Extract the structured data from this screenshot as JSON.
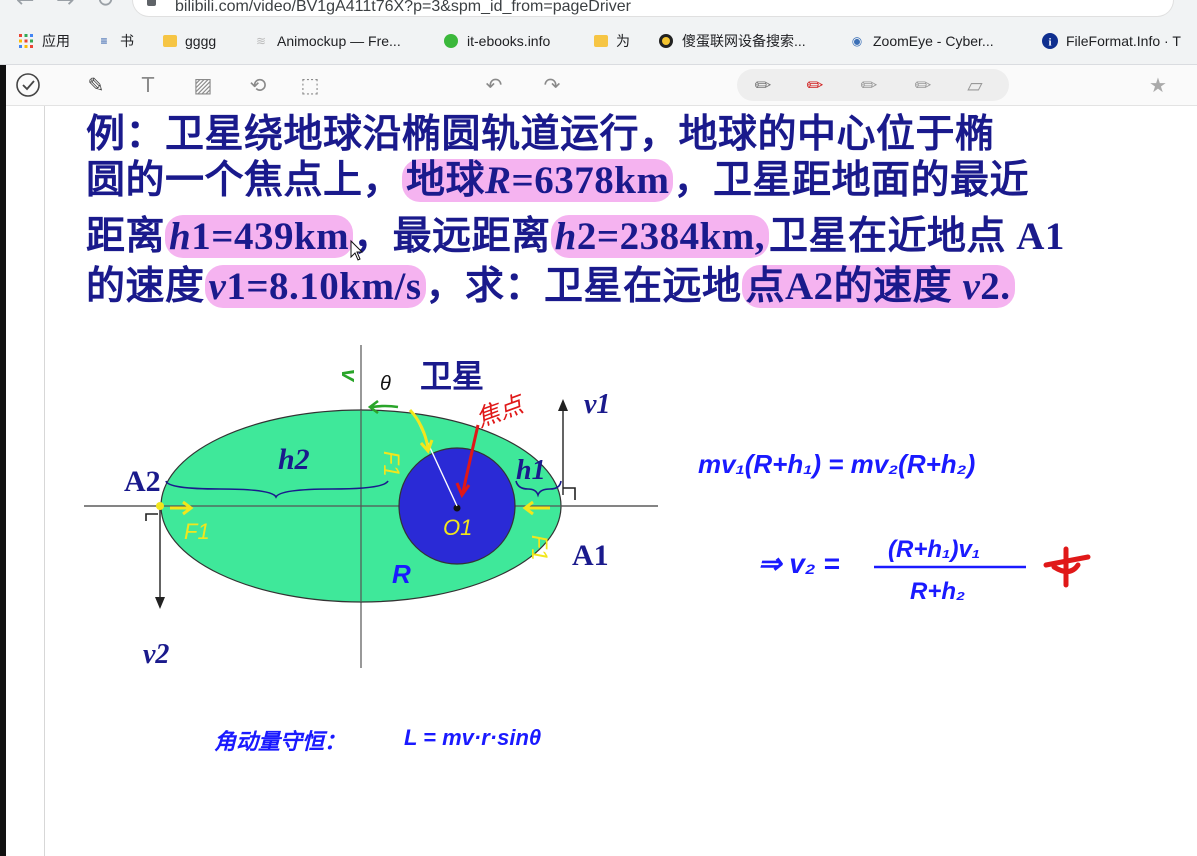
{
  "browser": {
    "url": "bilibili.com/video/BV1gA411t76X?p=3&spm_id_from=pageDriver",
    "bookmarks": [
      {
        "label": "应用",
        "icon": "apps-grid-icon"
      },
      {
        "label": "书",
        "icon": "book-icon"
      },
      {
        "label": "gggg",
        "icon": "folder-icon"
      },
      {
        "label": "Animockup — Fre...",
        "icon": "animockup-icon"
      },
      {
        "label": "it-ebooks.info",
        "icon": "green-ball-icon"
      },
      {
        "label": "为",
        "icon": "folder-icon"
      },
      {
        "label": "傻蛋联网设备搜索...",
        "icon": "shodan-icon"
      },
      {
        "label": "ZoomEye - Cyber...",
        "icon": "zoomeye-icon"
      },
      {
        "label": "FileFormat.Info · T",
        "icon": "info-icon"
      }
    ]
  },
  "toolbar": {
    "tools": [
      "check-icon",
      "pen-icon",
      "text-icon",
      "image-icon",
      "lasso-icon",
      "select-icon",
      "undo-icon",
      "redo-icon"
    ],
    "pens": [
      "pencil-icon",
      "marker-icon",
      "pen-grey-icon",
      "highlighter-icon",
      "eraser-icon"
    ],
    "star": "star-icon"
  },
  "problem": {
    "line1": "例：卫星绕地球沿椭圆轨道运行，地球的中心位于椭",
    "line2_a": "圆的一个焦点上，",
    "line2_hl": "地球",
    "line2_hl_var": "R",
    "line2_hl_val": "=6378km",
    "line2_b": "，卫星距地面的最近",
    "line3_a": "距离",
    "line3_hl1_var": "h",
    "line3_hl1_val": "1=439km",
    "line3_b": "，最远距离",
    "line3_hl2_var": "h",
    "line3_hl2_val": "2=2384km,",
    "line3_c": "卫星在近地点 A1",
    "line4_a": "的速度",
    "line4_hl1_var": "v",
    "line4_hl1_val": "1=8.10km/s",
    "line4_b": "，求：卫星在远地",
    "line4_hl2_a": "点A2的速度 ",
    "line4_hl2_var": "v",
    "line4_hl2_val": "2."
  },
  "diagram": {
    "label_satellite": "卫星",
    "label_v1": "v1",
    "label_v2": "v2",
    "label_A1": "A1",
    "label_A2": "A2",
    "label_h1": "h1",
    "label_h2": "h2",
    "label_R": "R",
    "handwritten_focus": "焦点",
    "handwritten_F_left": "F1",
    "handwritten_F_right": "F1",
    "handwritten_O1": "O1",
    "handwritten_v_top": "v",
    "handwritten_theta": "θ"
  },
  "handwriting": {
    "equation1": "mv₁(R+h₁) = mv₂(R+h₂)",
    "equation2_lhs": "⇒ v₂ =",
    "equation2_num": "(R+h₁)v₁",
    "equation2_den": "R+h₂",
    "note_label": "角动量守恒：",
    "note_formula": "L = mv·r·sinθ"
  },
  "colors": {
    "ink_blue": "#1a1aff",
    "text_navy": "#1a1a8c",
    "highlight": "#f5b3f0",
    "ellipse_fill": "#3fe89a",
    "earth_fill": "#2a2ad6",
    "yellow": "#f2e61c",
    "red": "#e01818",
    "green": "#2aa52a"
  }
}
